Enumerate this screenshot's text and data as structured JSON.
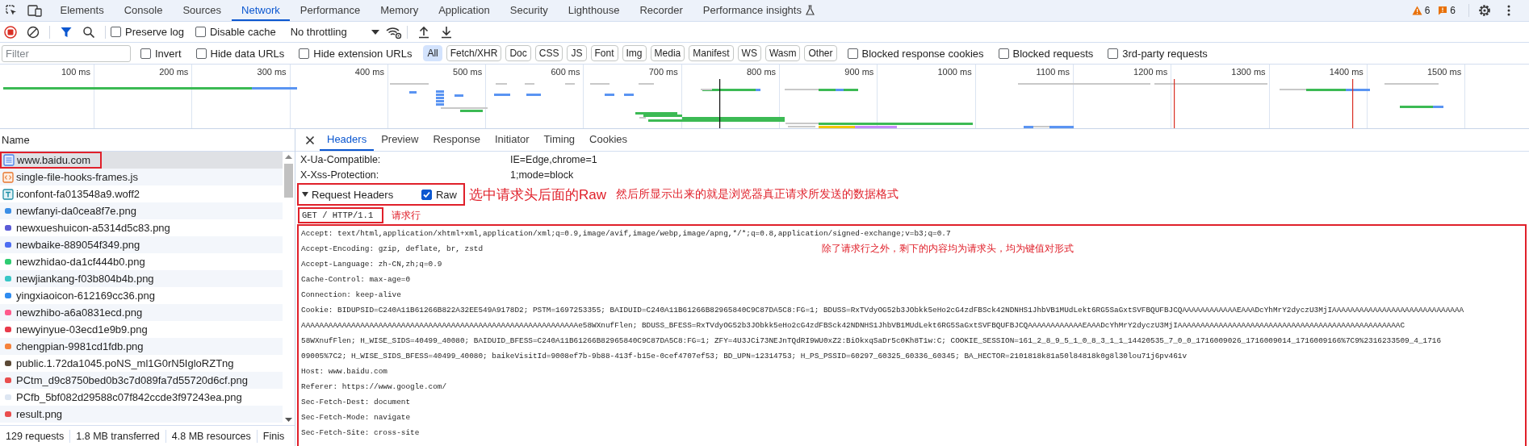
{
  "devtools_tabs": [
    {
      "label": "Elements",
      "selected": false
    },
    {
      "label": "Console",
      "selected": false
    },
    {
      "label": "Sources",
      "selected": false
    },
    {
      "label": "Network",
      "selected": true
    },
    {
      "label": "Performance",
      "selected": false
    },
    {
      "label": "Memory",
      "selected": false
    },
    {
      "label": "Application",
      "selected": false
    },
    {
      "label": "Security",
      "selected": false
    },
    {
      "label": "Lighthouse",
      "selected": false
    },
    {
      "label": "Recorder",
      "selected": false
    },
    {
      "label": "Performance insights",
      "selected": false
    }
  ],
  "issue_counters": [
    {
      "kind": "warning",
      "count": "6"
    },
    {
      "kind": "issue",
      "count": "6"
    }
  ],
  "toolbar": {
    "recording": true,
    "checkboxes": [
      {
        "label": "Preserve log",
        "checked": false
      },
      {
        "label": "Disable cache",
        "checked": false
      }
    ],
    "throttling": "No throttling"
  },
  "filter_bar": {
    "placeholder": "Filter",
    "options": [
      {
        "label": "Invert",
        "checked": false
      },
      {
        "label": "Hide data URLs",
        "checked": false
      },
      {
        "label": "Hide extension URLs",
        "checked": false
      }
    ],
    "type_chips": [
      {
        "label": "All",
        "selected": true
      },
      {
        "label": "Fetch/XHR",
        "selected": false
      },
      {
        "label": "Doc",
        "selected": false
      },
      {
        "label": "CSS",
        "selected": false
      },
      {
        "label": "JS",
        "selected": false
      },
      {
        "label": "Font",
        "selected": false
      },
      {
        "label": "Img",
        "selected": false
      },
      {
        "label": "Media",
        "selected": false
      },
      {
        "label": "Manifest",
        "selected": false
      },
      {
        "label": "WS",
        "selected": false
      },
      {
        "label": "Wasm",
        "selected": false
      },
      {
        "label": "Other",
        "selected": false
      }
    ],
    "more_options": [
      {
        "label": "Blocked response cookies",
        "checked": false
      },
      {
        "label": "Blocked requests",
        "checked": false
      },
      {
        "label": "3rd-party requests",
        "checked": false
      }
    ]
  },
  "timeline": {
    "ticks": [
      "100 ms",
      "200 ms",
      "300 ms",
      "400 ms",
      "500 ms",
      "600 ms",
      "700 ms",
      "800 ms",
      "900 ms",
      "1000 ms",
      "1100 ms",
      "1200 ms",
      "1300 ms",
      "1400 ms",
      "1500 ms"
    ]
  },
  "requests": {
    "column": "Name",
    "rows": [
      {
        "name": "www.baidu.com",
        "kind": "document",
        "selected": true
      },
      {
        "name": "single-file-hooks-frames.js",
        "kind": "script",
        "selected": false
      },
      {
        "name": "iconfont-fa013548a9.woff2",
        "kind": "font",
        "selected": false
      },
      {
        "name": "newfanyi-da0cea8f7e.png",
        "kind": "image",
        "color": "#3a8ee6",
        "selected": false
      },
      {
        "name": "newxueshuicon-a5314d5c83.png",
        "kind": "image",
        "color": "#5b5bd6",
        "selected": false
      },
      {
        "name": "newbaike-889054f349.png",
        "kind": "image",
        "color": "#4e6ef2",
        "selected": false
      },
      {
        "name": "newzhidao-da1cf444b0.png",
        "kind": "image",
        "color": "#2ecc71",
        "selected": false
      },
      {
        "name": "newjiankang-f03b804b4b.png",
        "kind": "image",
        "color": "#38c6c6",
        "selected": false
      },
      {
        "name": "yingxiaoicon-612169cc36.png",
        "kind": "image",
        "color": "#2f8cf0",
        "selected": false
      },
      {
        "name": "newzhibo-a6a0831ecd.png",
        "kind": "image",
        "color": "#ff5a8c",
        "selected": false
      },
      {
        "name": "newyinyue-03ecd1e9b9.png",
        "kind": "image",
        "color": "#e93a4a",
        "selected": false
      },
      {
        "name": "chengpian-9981cd1fdb.png",
        "kind": "image",
        "color": "#f5823c",
        "selected": false
      },
      {
        "name": "public.1.72da1045.poNS_ml1G0rN5IgloRZTng",
        "kind": "image",
        "color": "#5c4a36",
        "selected": false
      },
      {
        "name": "PCtm_d9c8750bed0b3c7d089fa7d55720d6cf.png",
        "kind": "image",
        "color": "#e94d4d",
        "selected": false
      },
      {
        "name": "PCfb_5bf082d29588c07f842ccde3f97243ea.png",
        "kind": "image",
        "color": "#dde6f2",
        "selected": false
      },
      {
        "name": "result.png",
        "kind": "image",
        "color": "#e94d4d",
        "selected": false
      }
    ]
  },
  "status_bar": [
    "129 requests",
    "1.8 MB transferred",
    "4.8 MB resources",
    "Finis"
  ],
  "detail": {
    "tabs": [
      {
        "label": "Headers",
        "selected": true
      },
      {
        "label": "Preview",
        "selected": false
      },
      {
        "label": "Response",
        "selected": false
      },
      {
        "label": "Initiator",
        "selected": false
      },
      {
        "label": "Timing",
        "selected": false
      },
      {
        "label": "Cookies",
        "selected": false
      }
    ],
    "response_headers": [
      {
        "name": "X-Ua-Compatible:",
        "value": "IE=Edge,chrome=1"
      },
      {
        "name": "X-Xss-Protection:",
        "value": "1;mode=block"
      }
    ],
    "request_headers": {
      "title": "Request Headers",
      "expanded": true,
      "raw": {
        "label": "Raw",
        "checked": true
      },
      "request_line": "GET / HTTP/1.1",
      "lines": [
        "Accept: text/html,application/xhtml+xml,application/xml;q=0.9,image/avif,image/webp,image/apng,*/*;q=0.8,application/signed-exchange;v=b3;q=0.7",
        "Accept-Encoding: gzip, deflate, br, zstd",
        "Accept-Language: zh-CN,zh;q=0.9",
        "Cache-Control: max-age=0",
        "Connection: keep-alive",
        "Cookie: BIDUPSID=C240A11B61266B822A32EE549A9178D2; PSTM=1697253355; BAIDUID=C240A11B61266B82965840C9C87DA5C8:FG=1; BDUSS=RxTVdyOG52b3JObkk5eHo2cG4zdFBSck42NDNHS1JhbVB1MUdLekt6RG5SaGxtSVFBQUFBJCQAAAAAAAAAAAAEAAADcYhMrY2dyczU3MjIAAAAAAAAAAAAAAAAAAAAAAAAAAAAA",
        "AAAAAAAAAAAAAAAAAAAAAAAAAAAAAAAAAAAAAAAAAAAAAAAAAAAAAAAAAAAAAe58WXnufFlen; BDUSS_BFESS=RxTVdyOG52b3JObkk5eHo2cG4zdFBSck42NDNHS1JhbVB1MUdLekt6RG5SaGxtSVFBQUFBJCQAAAAAAAAAAAAEAAADcYhMrY2dyczU3MjIAAAAAAAAAAAAAAAAAAAAAAAAAAAAAAAAAAAAAAAAAAAAAAAAAC",
        "58WXnufFlen; H_WISE_SIDS=40499_40080; BAIDUID_BFESS=C240A11B61266B82965840C9C87DA5C8:FG=1; ZFY=4U3JCi73NEJnTQdRI9WU0xZ2:BiOkxqSaDr5c0Kh8T1w:C; COOKIE_SESSION=161_2_8_9_5_1_0_8_3_1_1_14420535_7_0_0_1716009026_1716009014_1716009166%7C9%2316233509_4_1716",
        "09005%7C2; H_WISE_SIDS_BFESS=40499_40080; baikeVisitId=9008ef7b-9b88-413f-b15e-0cef4707ef53; BD_UPN=12314753; H_PS_PSSID=60297_60325_60336_60345; BA_HECTOR=2101818k81a50l84818k0g8l30lou71j6pv461v",
        "Host: www.baidu.com",
        "Referer: https://www.google.com/",
        "Sec-Fetch-Dest: document",
        "Sec-Fetch-Mode: navigate",
        "Sec-Fetch-Site: cross-site"
      ]
    }
  },
  "annotations": {
    "raw_tip": "选中请求头后面的Raw",
    "result_tip": "然后所显示出来的就是浏览器真正请求所发送的数据格式",
    "request_line_tip": "请求行",
    "headers_tip": "除了请求行之外，剩下的内容均为请求头，均为键值对形式"
  }
}
